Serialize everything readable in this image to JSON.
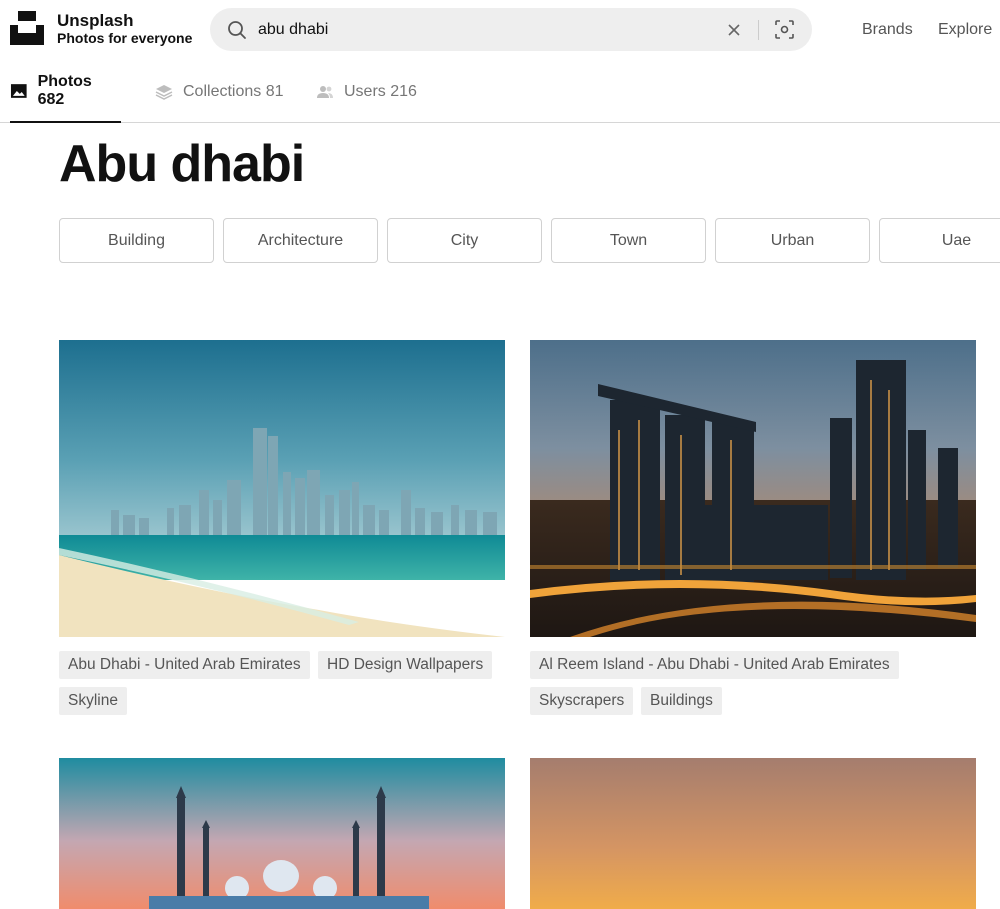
{
  "header": {
    "brand_name": "Unsplash",
    "brand_tagline": "Photos for everyone",
    "search": {
      "value": "abu dhabi",
      "icon": "search-icon"
    },
    "nav": [
      "Brands",
      "Explore"
    ]
  },
  "tabs": [
    {
      "label": "Photos 682",
      "icon": "image-icon",
      "active": true
    },
    {
      "label": "Collections 81",
      "icon": "stack-icon",
      "active": false
    },
    {
      "label": "Users 216",
      "icon": "users-icon",
      "active": false
    }
  ],
  "page": {
    "title": "Abu dhabi"
  },
  "related": [
    "Building",
    "Architecture",
    "City",
    "Town",
    "Urban",
    "Uae"
  ],
  "photos": [
    {
      "tags": [
        "Abu Dhabi - United Arab Emirates",
        "HD Design Wallpapers",
        "Skyline"
      ]
    },
    {
      "tags": [
        "Al Reem Island - Abu Dhabi - United Arab Emirates",
        "Skyscrapers",
        "Buildings"
      ]
    }
  ],
  "colors": {
    "accent": "#111111",
    "chip_border": "#d1d1d1",
    "tag_bg": "#eeeeee"
  }
}
